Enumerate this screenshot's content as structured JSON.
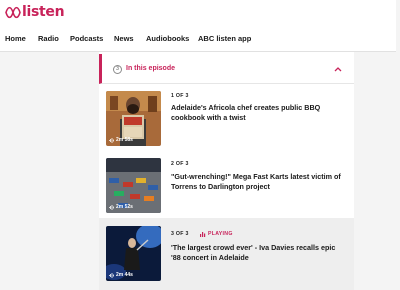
{
  "brand": {
    "logo_text": "listen",
    "accent": "#c8235a"
  },
  "nav": {
    "items": [
      {
        "label": "Home"
      },
      {
        "label": "Radio"
      },
      {
        "label": "Podcasts"
      },
      {
        "label": "News"
      },
      {
        "label": "Audiobooks"
      },
      {
        "label": "ABC listen app"
      }
    ]
  },
  "episode_panel": {
    "number": "3",
    "title": "In this episode",
    "expanded": true,
    "items": [
      {
        "position": "1 OF 3",
        "headline_line1": "Adelaide's Africola chef creates public BBQ",
        "headline_line2": "cookbook with a twist",
        "duration": "2m 58s",
        "playing": false
      },
      {
        "position": "2 OF 3",
        "headline_line1": "\"Gut-wrenching!\" Mega Fast Karts latest victim of",
        "headline_line2": "Torrens to Darlington project",
        "duration": "2m 52s",
        "playing": false
      },
      {
        "position": "3 OF 3",
        "status": "PLAYING",
        "headline_line1": "'The largest crowd ever' - Iva Davies recalls epic",
        "headline_line2": "'88 concert in Adelaide",
        "duration": "2m 44s",
        "playing": true
      }
    ]
  }
}
